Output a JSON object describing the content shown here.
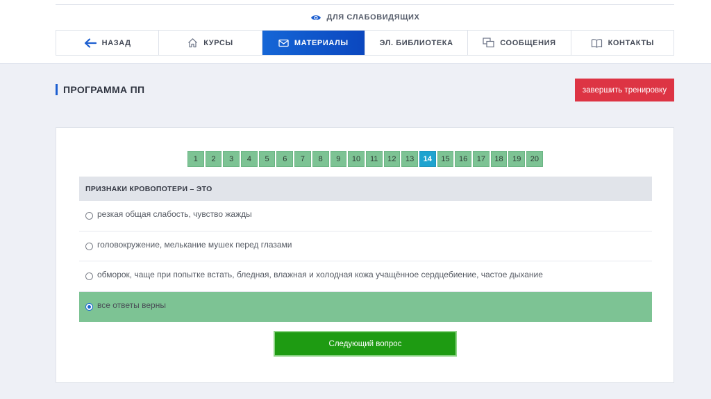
{
  "accessibility": {
    "label": "ДЛЯ СЛАБОВИДЯЩИХ",
    "icon": "eye-icon"
  },
  "nav": {
    "items": [
      {
        "label": "НАЗАД",
        "icon": "arrow-left-icon"
      },
      {
        "label": "КУРСЫ",
        "icon": "home-icon"
      },
      {
        "label": "МАТЕРИАЛЫ",
        "icon": "envelope-icon",
        "active": true
      },
      {
        "label": "ЭЛ. БИБЛИОТЕКА"
      },
      {
        "label": "СООБЩЕНИЯ",
        "icon": "messages-icon"
      },
      {
        "label": "КОНТАКТЫ",
        "icon": "book-icon"
      }
    ]
  },
  "page": {
    "title": "ПРОГРАММА ПП",
    "finish_label": "завершить тренировку"
  },
  "pager": {
    "pages": [
      "1",
      "2",
      "3",
      "4",
      "5",
      "6",
      "7",
      "8",
      "9",
      "10",
      "11",
      "12",
      "13",
      "14",
      "15",
      "16",
      "17",
      "18",
      "19",
      "20"
    ],
    "current": "14"
  },
  "question": {
    "title": "ПРИЗНАКИ КРОВОПОТЕРИ – ЭТО",
    "answers": [
      {
        "text": "резкая общая слабость, чувство жажды",
        "selected": false
      },
      {
        "text": "головокружение, мелькание мушек перед глазами",
        "selected": false
      },
      {
        "text": "обморок, чаще при попытке встать, бледная, влажная и холодная кожа учащённое сердцебиение, частое дыхание",
        "selected": false
      },
      {
        "text": "все ответы верны",
        "selected": true
      }
    ]
  },
  "next_label": "Следующий вопрос",
  "colors": {
    "accent": "#1566d6",
    "success": "#7dc394",
    "current_page": "#1fa3cf",
    "danger": "#dd3444",
    "next_button": "#1e9b12"
  }
}
